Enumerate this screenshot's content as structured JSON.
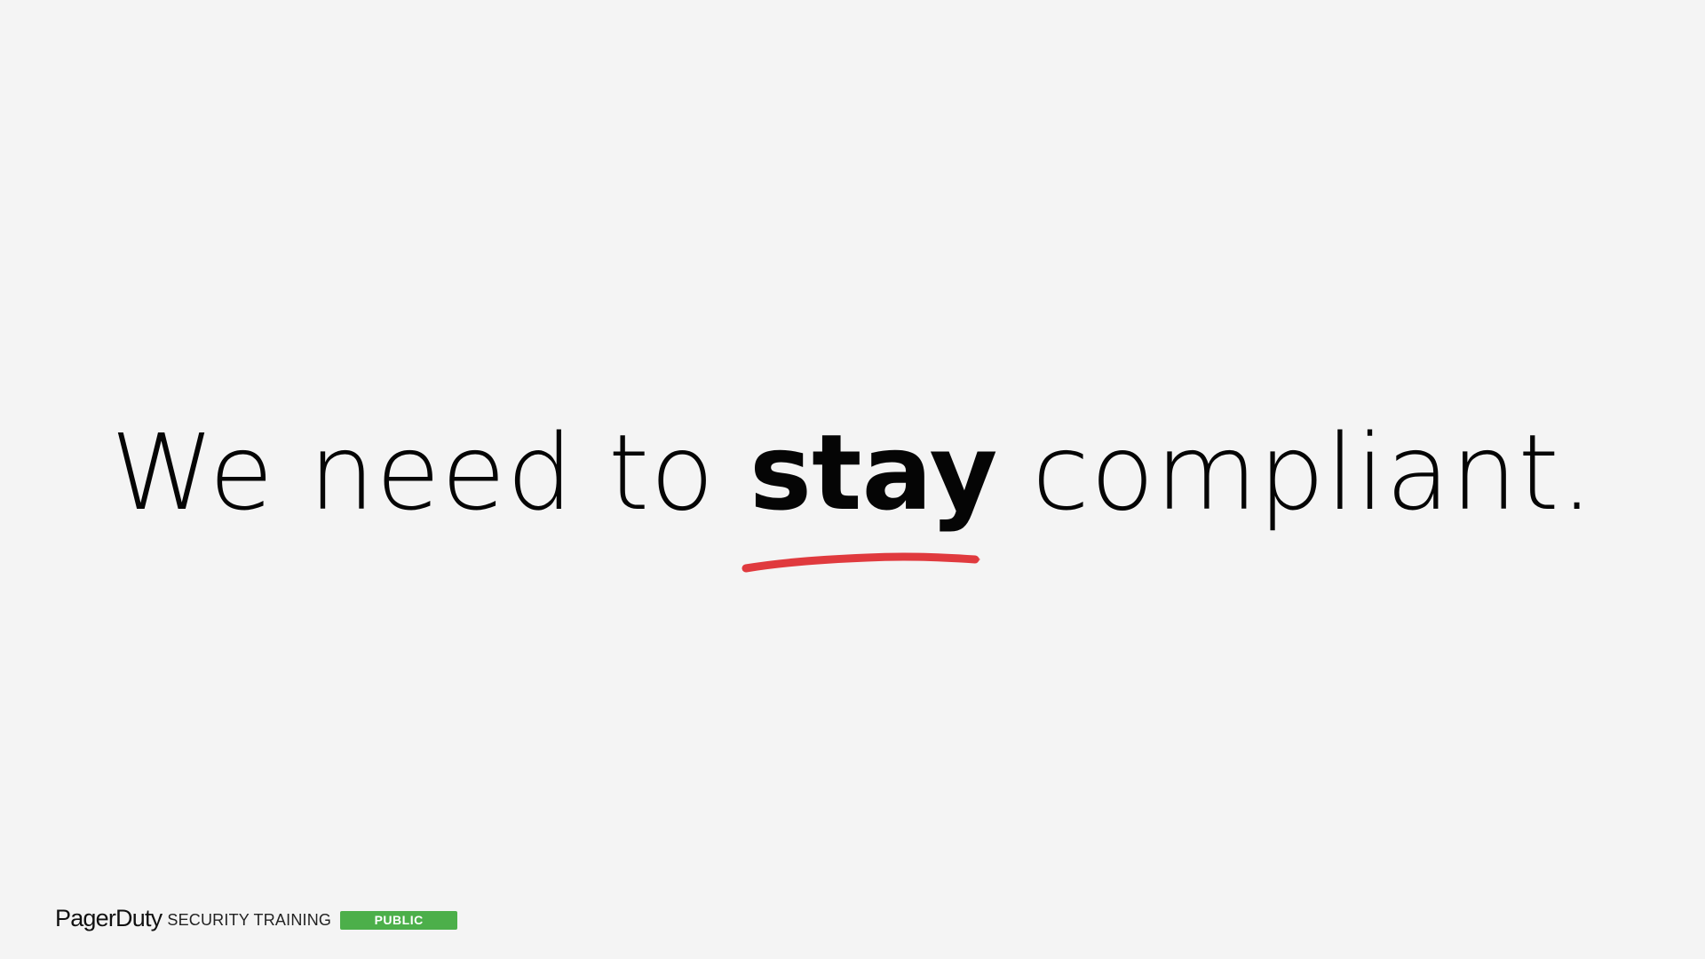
{
  "headline": {
    "part1": "We need to",
    "emphasis": "stay",
    "part2": "compliant."
  },
  "footer": {
    "brand": "PagerDuty",
    "label": "SECURITY TRAINING",
    "badge": "PUBLIC"
  },
  "colors": {
    "background": "#f4f4f4",
    "text": "#050505",
    "underline": "#e03a3e",
    "badge": "#4caf4a"
  }
}
